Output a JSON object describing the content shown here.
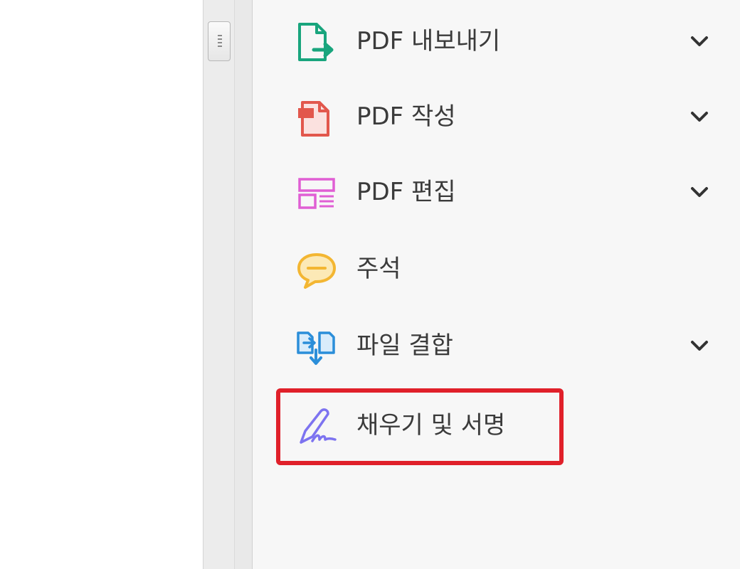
{
  "tools": {
    "export_pdf": {
      "label": "PDF 내보내기",
      "icon": "export-pdf-icon",
      "color": "#19a57d",
      "expandable": true
    },
    "create_pdf": {
      "label": "PDF 작성",
      "icon": "create-pdf-icon",
      "color": "#e2574c",
      "expandable": true
    },
    "edit_pdf": {
      "label": "PDF 편집",
      "icon": "edit-pdf-icon",
      "color": "#e05fd4",
      "expandable": true
    },
    "comment": {
      "label": "주석",
      "icon": "comment-icon",
      "color": "#f3b632",
      "expandable": false
    },
    "combine_files": {
      "label": "파일 결합",
      "icon": "combine-files-icon",
      "color": "#2b8ed9",
      "expandable": true
    },
    "fill_sign": {
      "label": "채우기 및 서명",
      "icon": "fill-sign-icon",
      "color": "#7d73f0",
      "expandable": false,
      "highlighted": true
    }
  },
  "colors": {
    "highlight_border": "#e0202a",
    "panel_bg": "#f7f7f7",
    "label_text": "#3b3b3b"
  }
}
